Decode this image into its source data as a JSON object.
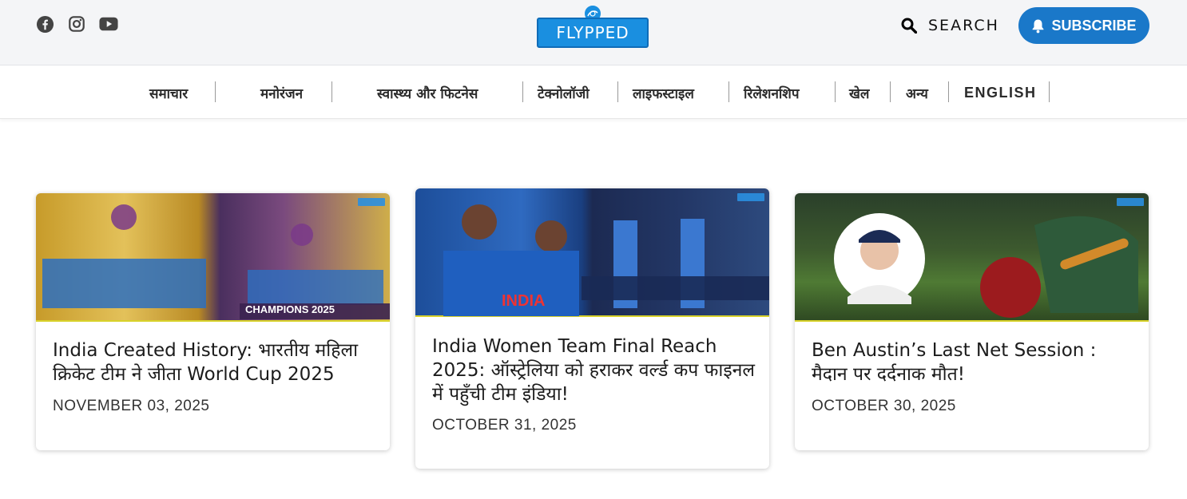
{
  "header": {
    "social_icons": [
      "facebook-icon",
      "instagram-icon",
      "youtube-icon"
    ],
    "logo_text": "FLYPPED",
    "search_label": "SEARCH",
    "subscribe_label": "SUBSCRIBE"
  },
  "nav": {
    "items": [
      "समाचार",
      "मनोरंजन",
      "स्वास्थ्य और फिटनेस",
      "टेक्नोलॉजी",
      "लाइफस्टाइल",
      "रिलेशनशिप",
      "खेल",
      "अन्य",
      "ENGLISH"
    ]
  },
  "articles": [
    {
      "title": "India Created History: भारतीय महिला क्रिकेट टीम ने जीता World Cup 2025",
      "date": "NOVEMBER 03, 2025",
      "image_caption": "CHAMPIONS 2025"
    },
    {
      "title": "India Women Team Final Reach 2025: ऑस्ट्रेलिया को हराकर वर्ल्ड कप फाइनल में पहुँची टीम इंडिया!",
      "date": "OCTOBER 31, 2025",
      "image_caption": "INDIA"
    },
    {
      "title": "Ben Austin’s Last Net Session : मैदान पर दर्दनाक मौत!",
      "date": "OCTOBER 30, 2025",
      "image_caption": ""
    }
  ],
  "colors": {
    "brand_blue": "#1a78c9",
    "topbar_bg": "#f4f5f7",
    "image_accent": "#d8d22a"
  }
}
